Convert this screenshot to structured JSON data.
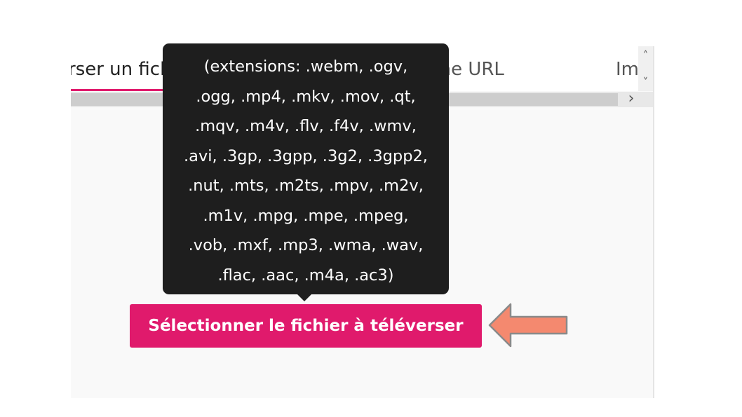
{
  "tabs": [
    {
      "label": "rser un fichier"
    },
    {
      "label": "Importer avec une URL"
    },
    {
      "label": "Im"
    }
  ],
  "scroll": {
    "right_glyph": "›",
    "up_glyph": "˄",
    "down_glyph": "˅"
  },
  "tooltip": {
    "lines": [
      "(extensions: .webm, .ogv,",
      ".ogg, .mp4, .mkv, .mov, .qt,",
      ".mqv, .m4v, .flv, .f4v, .wmv,",
      ".avi, .3gp, .3gpp, .3g2, .3gpp2,",
      ".nut, .mts, .m2ts, .mpv, .m2v,",
      ".m1v, .mpg, .mpe, .mpeg,",
      ".vob, .mxf, .mp3, .wma, .wav,",
      ".flac, .aac, .m4a, .ac3)"
    ]
  },
  "upload": {
    "button_label": "Sélectionner le fichier à téléverser"
  },
  "colors": {
    "accent": "#e01a6c",
    "tooltip_bg": "#1e1e1e",
    "annotation_arrow": "#f4896f"
  },
  "annotation": {
    "icon": "left-arrow-icon"
  }
}
